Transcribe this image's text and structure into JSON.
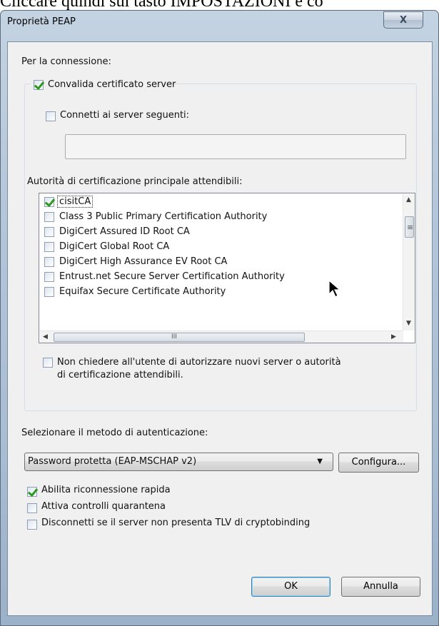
{
  "background": {
    "caption": "Cliccare quindi sul tasto IMPOSTAZIONI e co"
  },
  "window": {
    "title": "Proprietà PEAP",
    "close_glyph": "X"
  },
  "connection": {
    "heading": "Per la connessione:",
    "validate_cert": {
      "label": "Convalida certificato server",
      "checked": true
    },
    "connect_servers": {
      "label": "Connetti ai server seguenti:",
      "checked": false,
      "value": ""
    },
    "trusted_ca_heading": "Autorità di certificazione principale attendibili:",
    "ca_list": [
      {
        "label": "cisitCA",
        "checked": true
      },
      {
        "label": "Class 3 Public Primary Certification Authority",
        "checked": false
      },
      {
        "label": "DigiCert Assured ID Root CA",
        "checked": false
      },
      {
        "label": "DigiCert Global Root CA",
        "checked": false
      },
      {
        "label": "DigiCert High Assurance EV Root CA",
        "checked": false
      },
      {
        "label": "Entrust.net Secure Server Certification Authority",
        "checked": false
      },
      {
        "label": "Equifax Secure Certificate Authority",
        "checked": false
      }
    ],
    "no_prompt": {
      "label_line1": "Non chiedere all'utente di autorizzare nuovi server o autorità",
      "label_line2": "di certificazione attendibili.",
      "checked": false
    }
  },
  "auth": {
    "heading": "Selezionare il metodo di autenticazione:",
    "method_selected": "Password protetta (EAP-MSCHAP v2)",
    "configure_label": "Configura..."
  },
  "options": [
    {
      "label": "Abilita riconnessione rapida",
      "checked": true
    },
    {
      "label": "Attiva controlli quarantena",
      "checked": false
    },
    {
      "label": "Disconnetti se il server non presenta TLV di cryptobinding",
      "checked": false
    }
  ],
  "buttons": {
    "ok": "OK",
    "cancel": "Annulla"
  },
  "scrollbar": {
    "grip_v": "≡",
    "grip_h": "III"
  },
  "colors": {
    "check": "#2c9a1e",
    "default_button_border": "#3c7fb1"
  }
}
